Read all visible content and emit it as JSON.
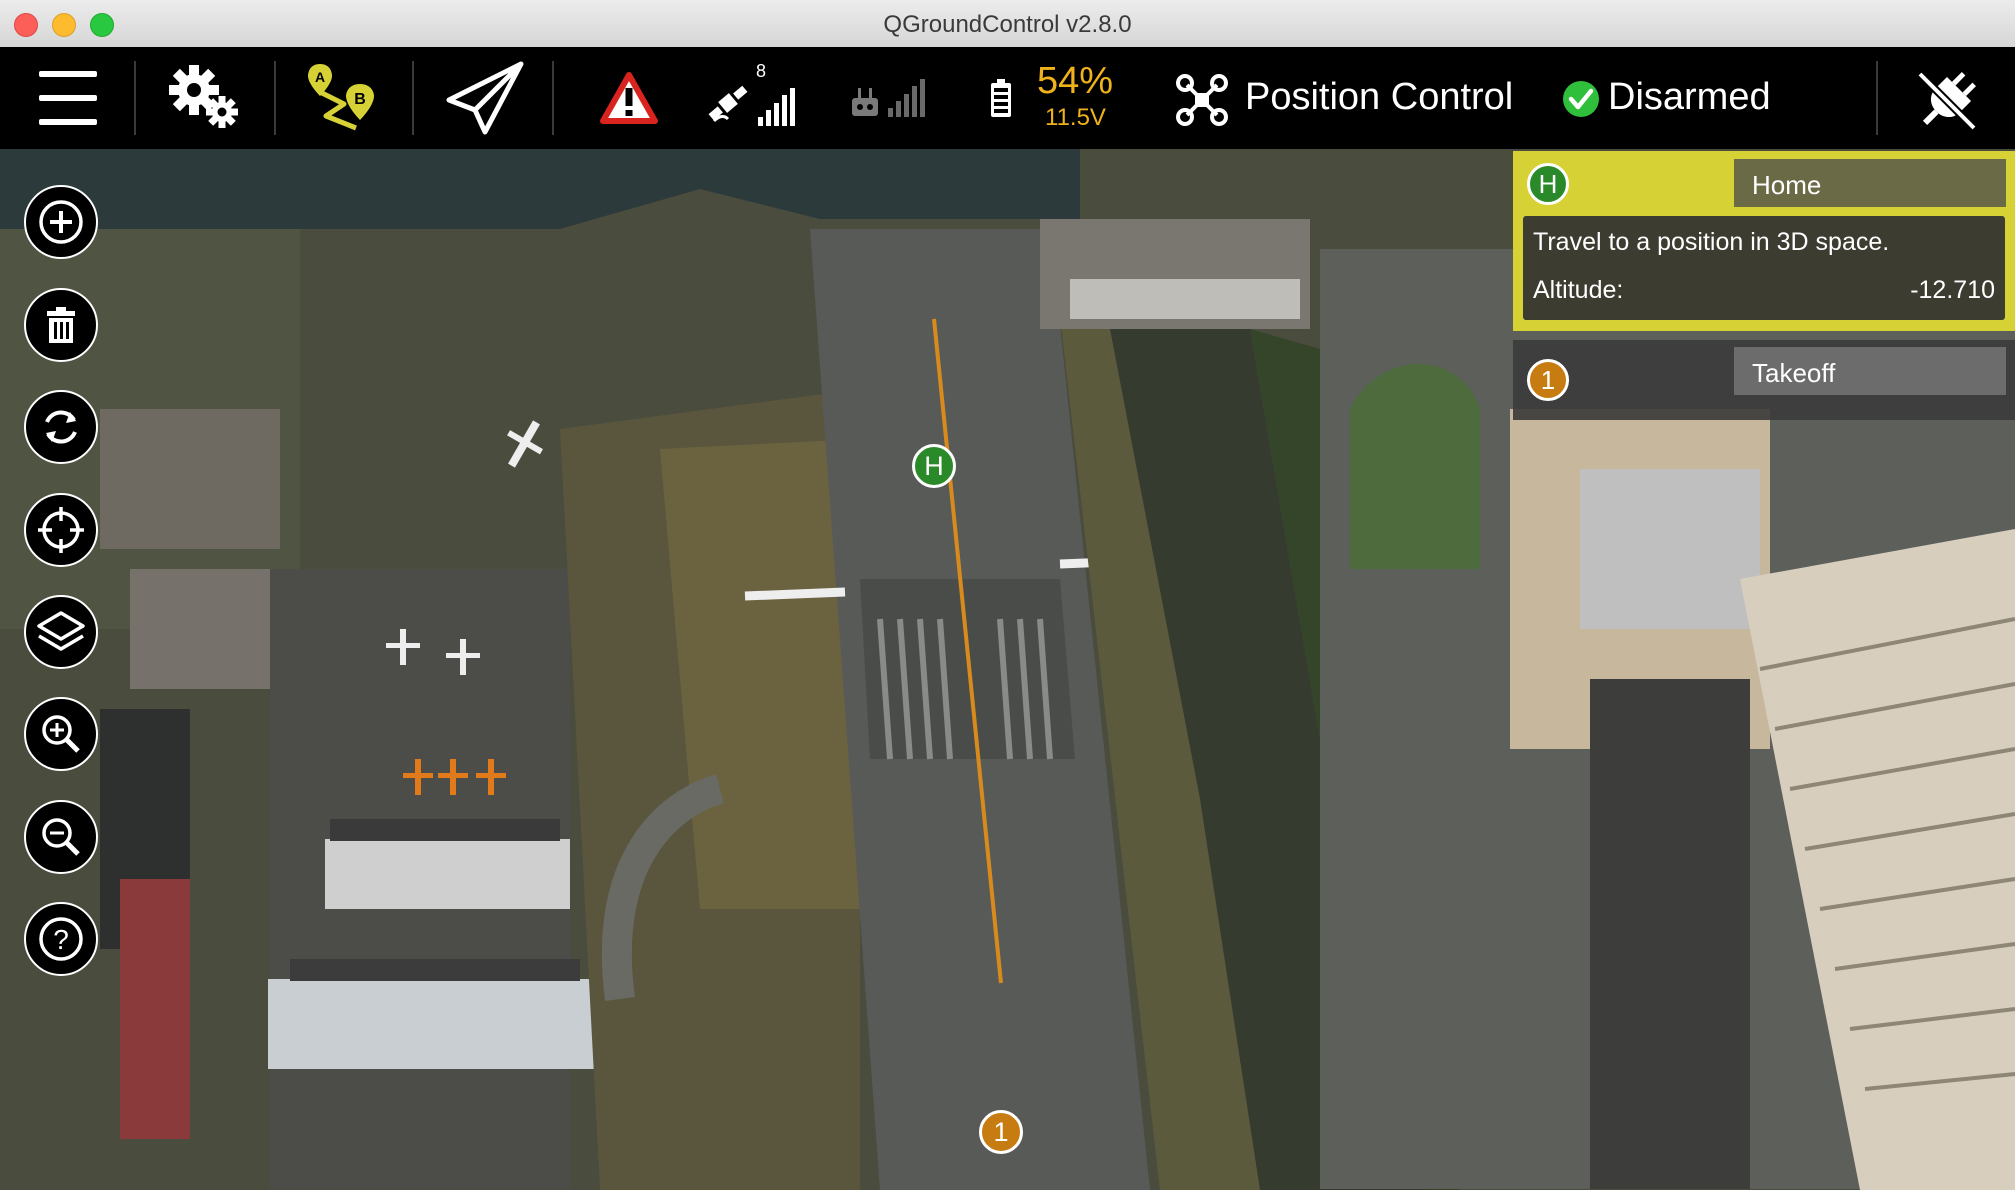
{
  "window": {
    "title": "QGroundControl v2.8.0"
  },
  "toolbar": {
    "menu_icon": "hamburger-menu-icon",
    "settings_icon": "gear-icon",
    "plan_icon": "waypoint-plan-icon",
    "fly_icon": "paper-plane-icon",
    "messages_icon": "warning-icon",
    "gps": {
      "icon": "satellite-icon",
      "satellite_count": "8"
    },
    "rc_icon": "rc-signal-icon",
    "battery": {
      "icon": "battery-icon",
      "percent": "54%",
      "voltage": "11.5V"
    },
    "flight_mode": {
      "icon": "quadcopter-icon",
      "label": "Position Control"
    },
    "arm_state": {
      "icon": "check-circle-icon",
      "label": "Disarmed"
    },
    "connect_icon": "disconnect-plug-icon"
  },
  "map_tools": [
    {
      "name": "add-waypoint-button",
      "icon": "plus-icon"
    },
    {
      "name": "delete-button",
      "icon": "trash-icon"
    },
    {
      "name": "sync-button",
      "icon": "sync-icon"
    },
    {
      "name": "center-button",
      "icon": "crosshair-icon"
    },
    {
      "name": "map-type-button",
      "icon": "layers-icon"
    },
    {
      "name": "zoom-in-button",
      "icon": "zoom-in-icon"
    },
    {
      "name": "zoom-out-button",
      "icon": "zoom-out-icon"
    },
    {
      "name": "help-button",
      "icon": "help-icon"
    }
  ],
  "mission_items": [
    {
      "index": "H",
      "command": "Home",
      "description": "Travel to a position in 3D space.",
      "field_label": "Altitude:",
      "field_value": "-12.710"
    },
    {
      "index": "1",
      "command": "Takeoff"
    }
  ],
  "map_markers": {
    "home": "H",
    "waypoint": "1"
  },
  "colors": {
    "accent_yellow": "#d6d236",
    "home_green": "#2a8a2a",
    "waypoint_orange": "#c77c12",
    "battery_text": "#f0b21a",
    "flight_path": "#d98a1c"
  }
}
